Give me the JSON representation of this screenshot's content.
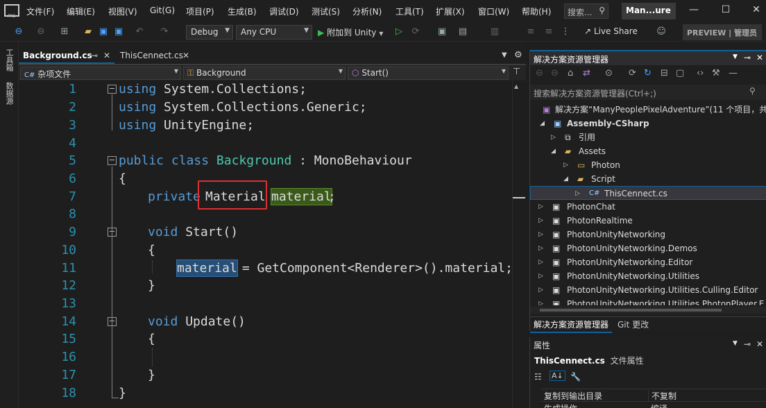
{
  "menu": {
    "file": "文件(F)",
    "edit": "编辑(E)",
    "view": "视图(V)",
    "git": "Git(G)",
    "project": "项目(P)",
    "build": "生成(B)",
    "debug": "调试(D)",
    "test": "测试(S)",
    "analyze": "分析(N)",
    "tools": "工具(T)",
    "extensions": "扩展(X)",
    "window": "窗口(W)",
    "help": "帮助(H)"
  },
  "search": {
    "placeholder": "搜索..."
  },
  "window_title": "Man...ure",
  "toolbar": {
    "config": "Debug",
    "platform": "Any CPU",
    "attach": "附加到 Unity",
    "live_share": "Live Share",
    "preview_badge": "PREVIEW | 管理员"
  },
  "left_tabs": {
    "toolbox": "工具箱",
    "datasource": "数据源"
  },
  "tabs": [
    {
      "label": "Background.cs",
      "active": true
    },
    {
      "label": "ThisCennect.cs",
      "active": false
    }
  ],
  "navbar": {
    "project": "杂项文件",
    "class": "Background",
    "member": "Start()"
  },
  "code": {
    "line_numbers": [
      "1",
      "2",
      "3",
      "4",
      "5",
      "6",
      "7",
      "8",
      "9",
      "10",
      "11",
      "12",
      "13",
      "14",
      "15",
      "16",
      "17",
      "18"
    ],
    "l1_kw": "using",
    "l1_rest": " System.Collections;",
    "l2_kw": "using",
    "l2_rest": " System.Collections.Generic;",
    "l3_kw": "using",
    "l3_rest": " UnityEngine;",
    "l5_kw1": "public",
    "l5_kw2": "class",
    "l5_type": "Background",
    "l5_rest": " : MonoBehaviour",
    "l6": "{",
    "l7_kw": "private",
    "l7_type": "Material",
    "l7_var": "material",
    "l7_end": ";",
    "l9_kw": "void",
    "l9_rest": " Start()",
    "l10": "{",
    "l11_var": "material",
    "l11_rest": " = GetComponent<Renderer>().material;",
    "l12": "}",
    "l14_kw": "void",
    "l14_rest": " Update()",
    "l15": "{",
    "l17": "}",
    "l18": "}"
  },
  "solution_explorer": {
    "title": "解决方案资源管理器",
    "search_placeholder": "搜索解决方案资源管理器(Ctrl+;)",
    "items": [
      {
        "label": "解决方案“ManyPeoplePixelAdventure”(11 个项目，共"
      },
      {
        "label": "Assembly-CSharp"
      },
      {
        "label": "引用"
      },
      {
        "label": "Assets"
      },
      {
        "label": "Photon"
      },
      {
        "label": "Script"
      },
      {
        "label": "ThisCennect.cs"
      },
      {
        "label": "PhotonChat"
      },
      {
        "label": "PhotonRealtime"
      },
      {
        "label": "PhotonUnityNetworking"
      },
      {
        "label": "PhotonUnityNetworking.Demos"
      },
      {
        "label": "PhotonUnityNetworking.Editor"
      },
      {
        "label": "PhotonUnityNetworking.Utilities"
      },
      {
        "label": "PhotonUnityNetworking.Utilities.Culling.Editor"
      },
      {
        "label": "PhotonUnityNetworking.Utilities.PhotonPlayer.E"
      }
    ],
    "bottom_tabs": [
      "解决方案资源管理器",
      "Git 更改"
    ]
  },
  "properties": {
    "title": "属性",
    "object": "ThisCennect.cs",
    "object_type": "文件属性",
    "rows": [
      {
        "name": "复制到输出目录",
        "value": "不复制"
      },
      {
        "name": "生成操作",
        "value": "编译"
      }
    ]
  },
  "colors": {
    "accent": "#0e639c",
    "highlight_border": "#e03030",
    "selected_row": "#37373d"
  }
}
